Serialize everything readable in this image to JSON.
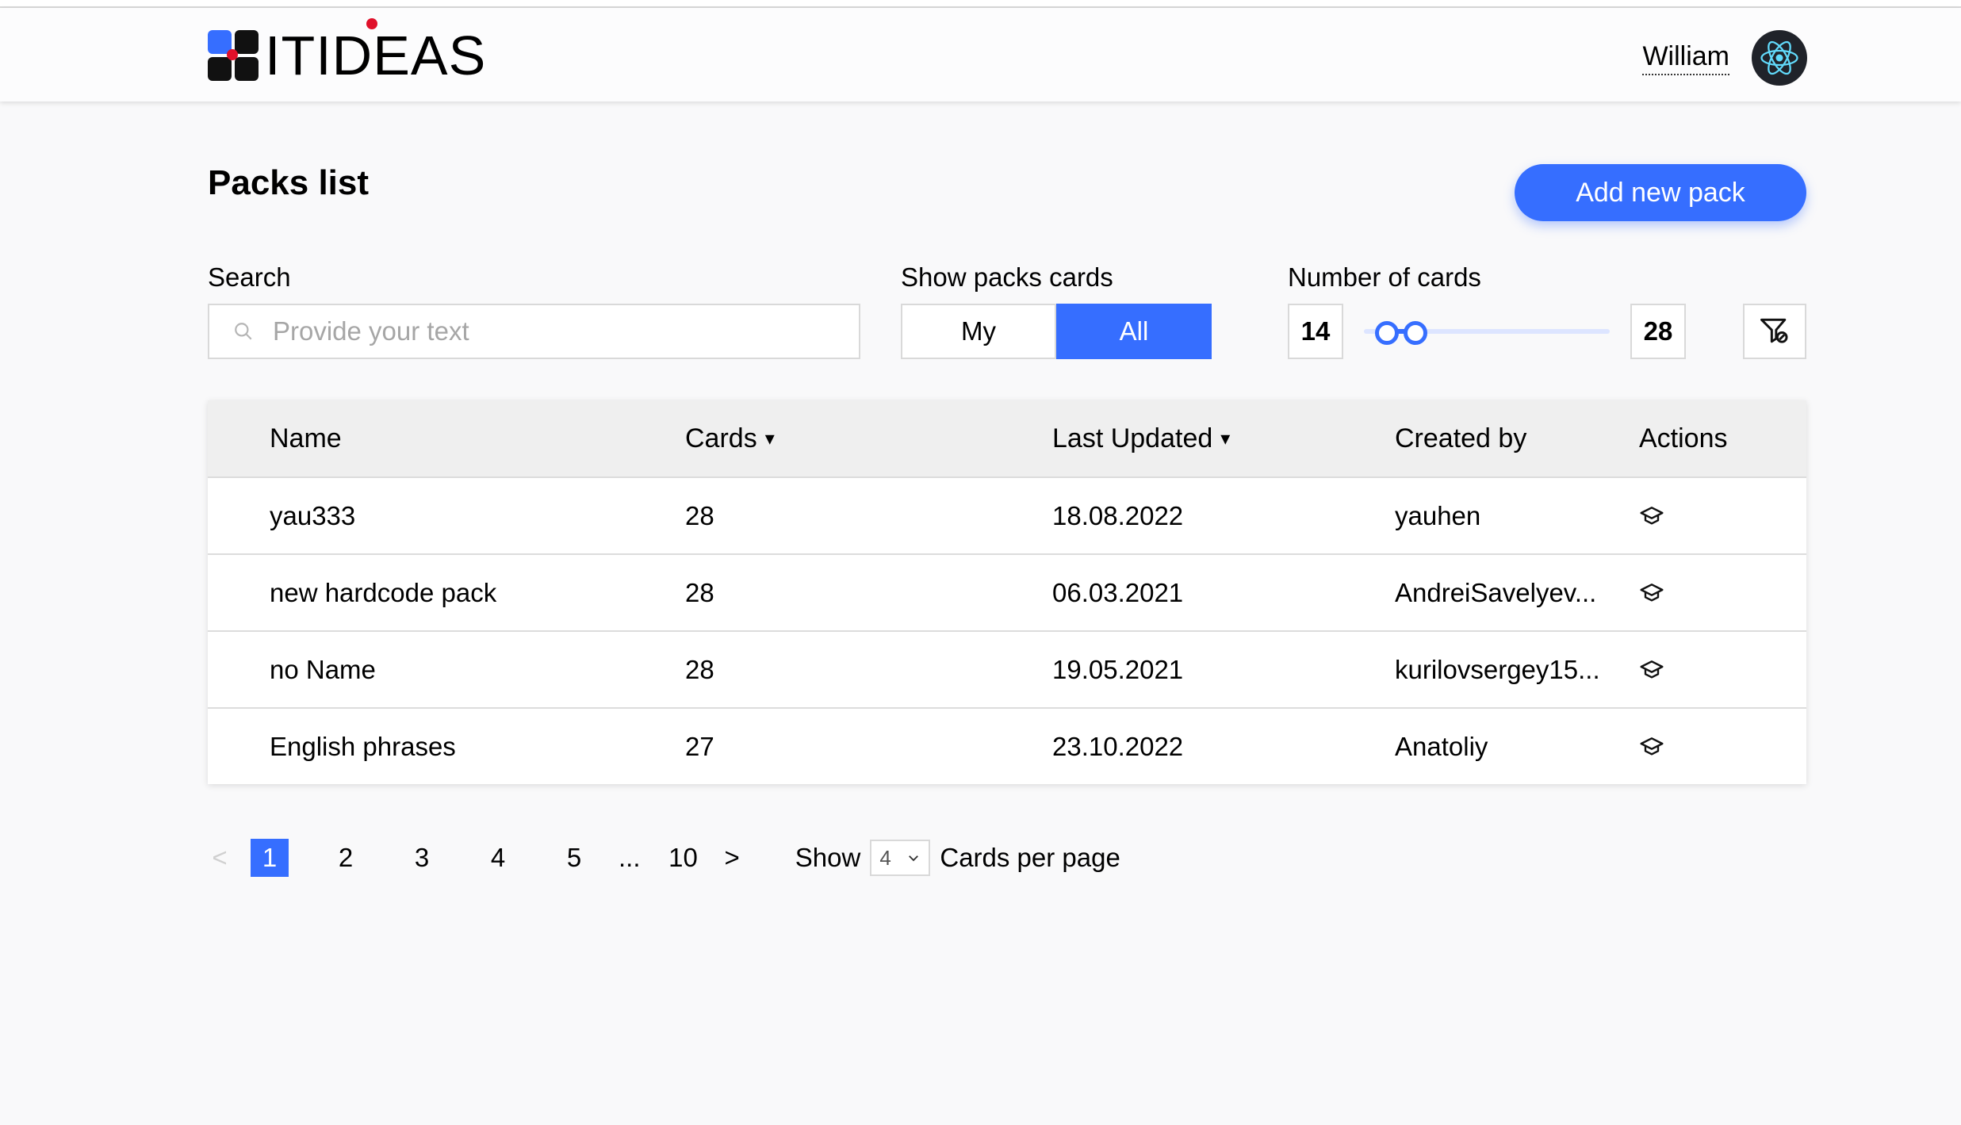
{
  "header": {
    "logo_text": "ITIDEAS",
    "user_name": "William",
    "avatar_icon": "react-atom-icon"
  },
  "page": {
    "title": "Packs list",
    "add_button": "Add new pack"
  },
  "filters": {
    "search_label": "Search",
    "search_placeholder": "Provide your text",
    "search_value": "",
    "show_label": "Show packs cards",
    "show_options": [
      "My",
      "All"
    ],
    "show_selected": "All",
    "number_label": "Number of cards",
    "min": "14",
    "max": "28",
    "slider_min_fraction": 0.05,
    "slider_max_fraction": 0.18,
    "reset_icon": "filter-reset-icon"
  },
  "table": {
    "headers": {
      "name": "Name",
      "cards": "Cards",
      "updated": "Last Updated",
      "created": "Created by",
      "actions": "Actions"
    },
    "sort_marker": "▾",
    "rows": [
      {
        "name": "yau333",
        "cards": "28",
        "updated": "18.08.2022",
        "created": "yauhen"
      },
      {
        "name": "new hardcode pack",
        "cards": "28",
        "updated": "06.03.2021",
        "created": "AndreiSavelyev..."
      },
      {
        "name": "no Name",
        "cards": "28",
        "updated": "19.05.2021",
        "created": "kurilovsergey15..."
      },
      {
        "name": "English phrases",
        "cards": "27",
        "updated": "23.10.2022",
        "created": "Anatoliy"
      }
    ],
    "action_icon": "learn-cap-icon"
  },
  "pagination": {
    "prev": "<",
    "pages": [
      "1",
      "2",
      "3",
      "4",
      "5"
    ],
    "current": "1",
    "dots": "...",
    "last": "10",
    "next": ">",
    "show_label": "Show",
    "per_page_value": "4",
    "per_page_suffix": "Cards per page"
  },
  "colors": {
    "accent": "#366eff",
    "background": "#f9f9fa",
    "header_bg": "#efefef"
  }
}
